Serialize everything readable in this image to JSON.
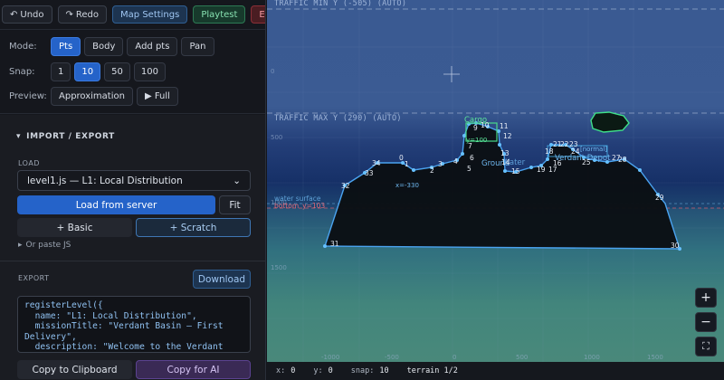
{
  "toolbar": {
    "undo": "Undo",
    "redo": "Redo",
    "map_settings": "Map Settings",
    "playtest": "Playtest",
    "exit": "Exit"
  },
  "mode": {
    "label": "Mode:",
    "options": [
      "Pts",
      "Body",
      "Add pts",
      "Pan"
    ],
    "selected": "Pts"
  },
  "snap": {
    "label": "Snap:",
    "options": [
      "1",
      "10",
      "50",
      "100"
    ],
    "selected": "10"
  },
  "preview": {
    "label": "Preview:",
    "approx": "Approximation",
    "full": "▶ Full"
  },
  "import_export": {
    "title": "IMPORT / EXPORT",
    "load_caption": "LOAD",
    "level_select": "level1.js — L1: Local Distribution",
    "load_server": "Load from server",
    "fit": "Fit",
    "basic": "+ Basic",
    "scratch": "+ Scratch",
    "paste": "Or paste JS",
    "export_caption": "EXPORT",
    "download": "Download",
    "code": "registerLevel({\n  name: \"L1: Local Distribution\",\n  missionTitle: \"Verdant Basin — First Delivery\",\n  description: \"Welcome to the Verdant Basin, your first posting as a certified cargo",
    "copy_clipboard": "Copy to Clipboard",
    "copy_ai": "Copy for AI"
  },
  "canvas": {
    "traffic_min": "TRAFFIC MIN Y (-505) (AUTO)",
    "traffic_max": "TRAFFIC MAX Y (290) (AUTO)",
    "y_ticks": [
      "0",
      "500",
      "1000",
      "1500"
    ],
    "x_ticks": [
      "-1000",
      "-500",
      "0",
      "500",
      "1000",
      "1500"
    ],
    "labels": {
      "cargo": "Cargo",
      "ground": "Ground",
      "water": "Water",
      "depot": "Verdant Depot",
      "normal": "[normal]",
      "water_surface": "water surface",
      "bottom": "bottom",
      "y100": "y=100",
      "x330": "x=-330",
      "y103": "y=103"
    },
    "vertex_numbers": [
      "0",
      "1",
      "2",
      "3",
      "4",
      "5",
      "6",
      "7",
      "8",
      "9",
      "10",
      "11",
      "12",
      "13",
      "14",
      "15",
      "16",
      "17",
      "18",
      "19",
      "20",
      "21",
      "22",
      "23",
      "24",
      "25",
      "26",
      "27",
      "28",
      "29",
      "30",
      "31",
      "32",
      "33",
      "34"
    ]
  },
  "zoom": {
    "in": "+",
    "out": "−",
    "fit": "⛶"
  },
  "status": {
    "x_label": "x:",
    "x": "0",
    "y_label": "y:",
    "y": "0",
    "snap_label": "snap:",
    "snap": "10",
    "terrain": "terrain 1/2"
  }
}
